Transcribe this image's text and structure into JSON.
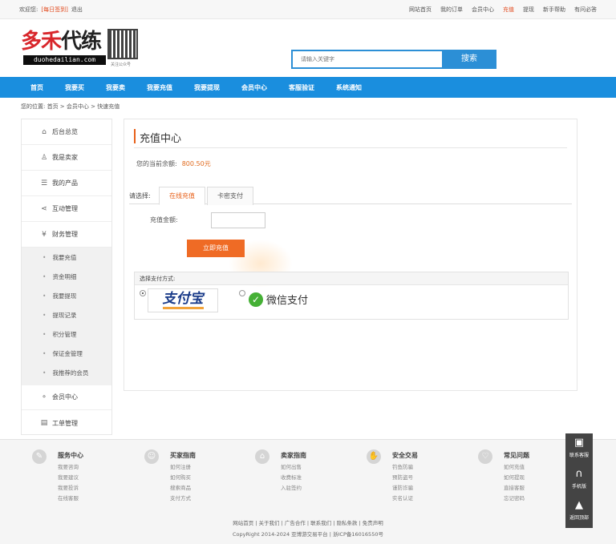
{
  "topbar": {
    "welcome": "欢迎您:",
    "user": "[每日签到]",
    "logout": "退出",
    "links": [
      "网站首页",
      "我的订单",
      "会员中心",
      "充值",
      "提现",
      "新手帮助",
      "有问必答"
    ]
  },
  "logo": {
    "title_a": "多禾",
    "title_b": "代练",
    "domain": "duohedailian.com",
    "qr_caption": "关注公众号"
  },
  "search": {
    "placeholder": "请输入关键字",
    "button": "搜索"
  },
  "nav": [
    "首页",
    "我要买",
    "我要卖",
    "我要充值",
    "我要提现",
    "会员中心",
    "客服验证",
    "系统通知"
  ],
  "breadcrumb": "您的位置: 首页 > 会员中心 > 快速充值",
  "sidebar": {
    "items": [
      {
        "label": "后台总览",
        "icon": "home-icon",
        "glyph": "⌂"
      },
      {
        "label": "我是卖家",
        "icon": "user-icon",
        "glyph": "♙"
      },
      {
        "label": "我的产品",
        "icon": "list-icon",
        "glyph": "☰"
      },
      {
        "label": "互动管理",
        "icon": "share-icon",
        "glyph": "⋖"
      },
      {
        "label": "财务管理",
        "icon": "yen-icon",
        "glyph": "¥"
      }
    ],
    "sub": [
      "我要充值",
      "资金明细",
      "我要提现",
      "提现记录",
      "积分管理",
      "保证金管理",
      "我推荐的会员"
    ],
    "bottom": [
      {
        "label": "会员中心",
        "icon": "members-icon",
        "glyph": "⚬"
      },
      {
        "label": "工单管理",
        "icon": "ticket-icon",
        "glyph": "▤"
      }
    ]
  },
  "content": {
    "title": "充值中心",
    "balance_label": "您的当前余额:",
    "balance_value": "800.50元",
    "tabs_label": "请选择:",
    "tabs": [
      "在线充值",
      "卡密支付"
    ],
    "amount_label": "充值金额:",
    "submit": "立即充值",
    "pay_header": "选择支付方式:",
    "alipay": "支付宝",
    "wechat": "微信支付"
  },
  "footer": {
    "columns": [
      {
        "title": "服务中心",
        "links": [
          "我要咨询",
          "我要建议",
          "我要投诉",
          "在线客服"
        ],
        "glyph": "✎"
      },
      {
        "title": "买家指南",
        "links": [
          "如何注册",
          "如何购买",
          "搜索商品",
          "支付方式"
        ],
        "glyph": "☺"
      },
      {
        "title": "卖家指南",
        "links": [
          "如何出售",
          "收费标准",
          "入驻签约"
        ],
        "glyph": "⌂"
      },
      {
        "title": "安全交易",
        "links": [
          "钓鱼防骗",
          "预防盗号",
          "谨防诈骗",
          "实名认证"
        ],
        "glyph": "✋"
      },
      {
        "title": "常见问题",
        "links": [
          "如何充值",
          "如何提现",
          "直接客服",
          "忘记密码"
        ],
        "glyph": "♡"
      }
    ],
    "links": "网站首页 | 关于我们 | 广告合作 | 联系我们 | 隐私条款 | 免责声明",
    "copyright": "CopyRight 2014-2024 亚博游交易平台 | 浙ICP备16016550号"
  },
  "side_tools": [
    {
      "label": "联系客服",
      "icon": "chat-icon",
      "glyph": "▣"
    },
    {
      "label": "手机版",
      "icon": "headset-icon",
      "glyph": "∩"
    },
    {
      "label": "返回顶部",
      "icon": "rocket-icon",
      "glyph": "▲"
    }
  ],
  "colors": {
    "nav": "#1a8ede",
    "accent": "#ef6b25",
    "balance": "#e06a1d"
  }
}
